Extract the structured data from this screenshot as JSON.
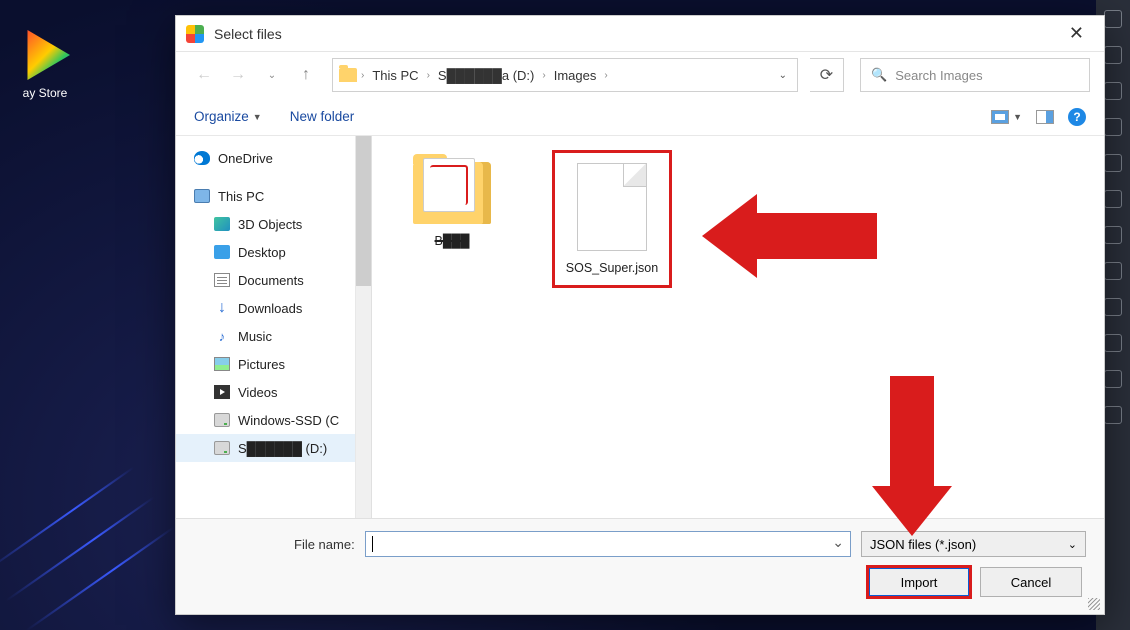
{
  "desktop": {
    "play_store_label": "ay Store"
  },
  "dialog": {
    "title": "Select files",
    "breadcrumb": {
      "root_icon": "folder",
      "c1": "This PC",
      "c2": "S██████a (D:)",
      "c3": "Images"
    },
    "search": {
      "placeholder": "Search Images"
    },
    "toolbar": {
      "organize": "Organize",
      "new_folder": "New folder",
      "help": "?"
    },
    "tree": {
      "onedrive": "OneDrive",
      "thispc": "This PC",
      "objects3d": "3D Objects",
      "desktop": "Desktop",
      "documents": "Documents",
      "downloads": "Downloads",
      "music": "Music",
      "pictures": "Pictures",
      "videos": "Videos",
      "winssd": "Windows-SSD (C",
      "drive_d": "S██████ (D:)"
    },
    "files": {
      "folder1": "B███",
      "file1": "SOS_Super.json"
    },
    "footer": {
      "filename_label": "File name:",
      "filename_value": "",
      "filetype": "JSON files (*.json)",
      "import": "Import",
      "cancel": "Cancel"
    }
  }
}
